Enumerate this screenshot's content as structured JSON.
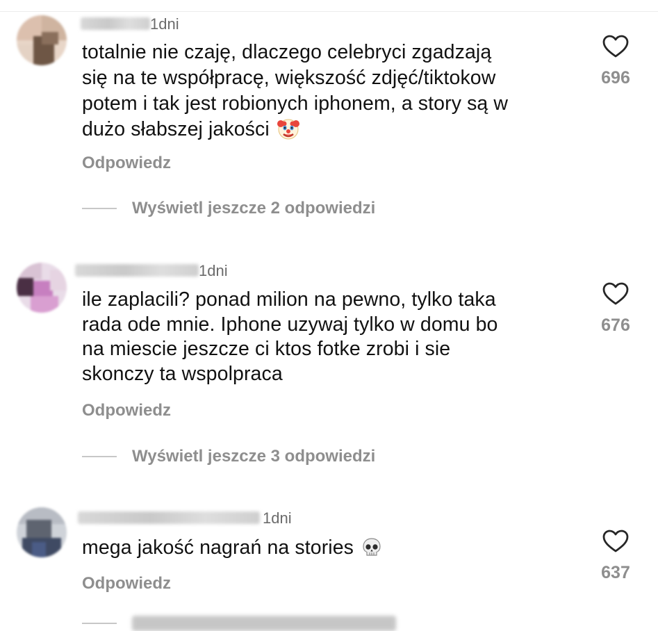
{
  "comments": [
    {
      "time": "1dni",
      "lines": [
        "totalnie nie czaję, dlaczego celebryci zgadzają",
        "się na te współpracę, większość zdjęć/tiktokow",
        "potem i tak jest robionych iphonem, a story są w",
        "dużo słabszej jakości"
      ],
      "emoji": "clown-face",
      "reply_label": "Odpowiedz",
      "likes": "696",
      "view_replies": "Wyświetl jeszcze 2 odpowiedzi"
    },
    {
      "time": "1dni",
      "lines": [
        "ile zaplacili? ponad milion na pewno, tylko taka",
        "rada ode mnie. Iphone uzywaj tylko w domu bo",
        "na miescie jeszcze ci ktos fotke zrobi i sie",
        "skonczy ta wspolpraca"
      ],
      "reply_label": "Odpowiedz",
      "likes": "676",
      "view_replies": "Wyświetl jeszcze 3 odpowiedzi"
    },
    {
      "time": "1dni",
      "lines": [
        "mega jakość nagrań na stories"
      ],
      "emoji": "skull",
      "reply_label": "Odpowiedz",
      "likes": "637"
    }
  ],
  "colors": {
    "text": "#111111",
    "secondary": "#8e8e8e",
    "timestamp": "#6b6b6b",
    "divider": "#c7c7c7"
  }
}
